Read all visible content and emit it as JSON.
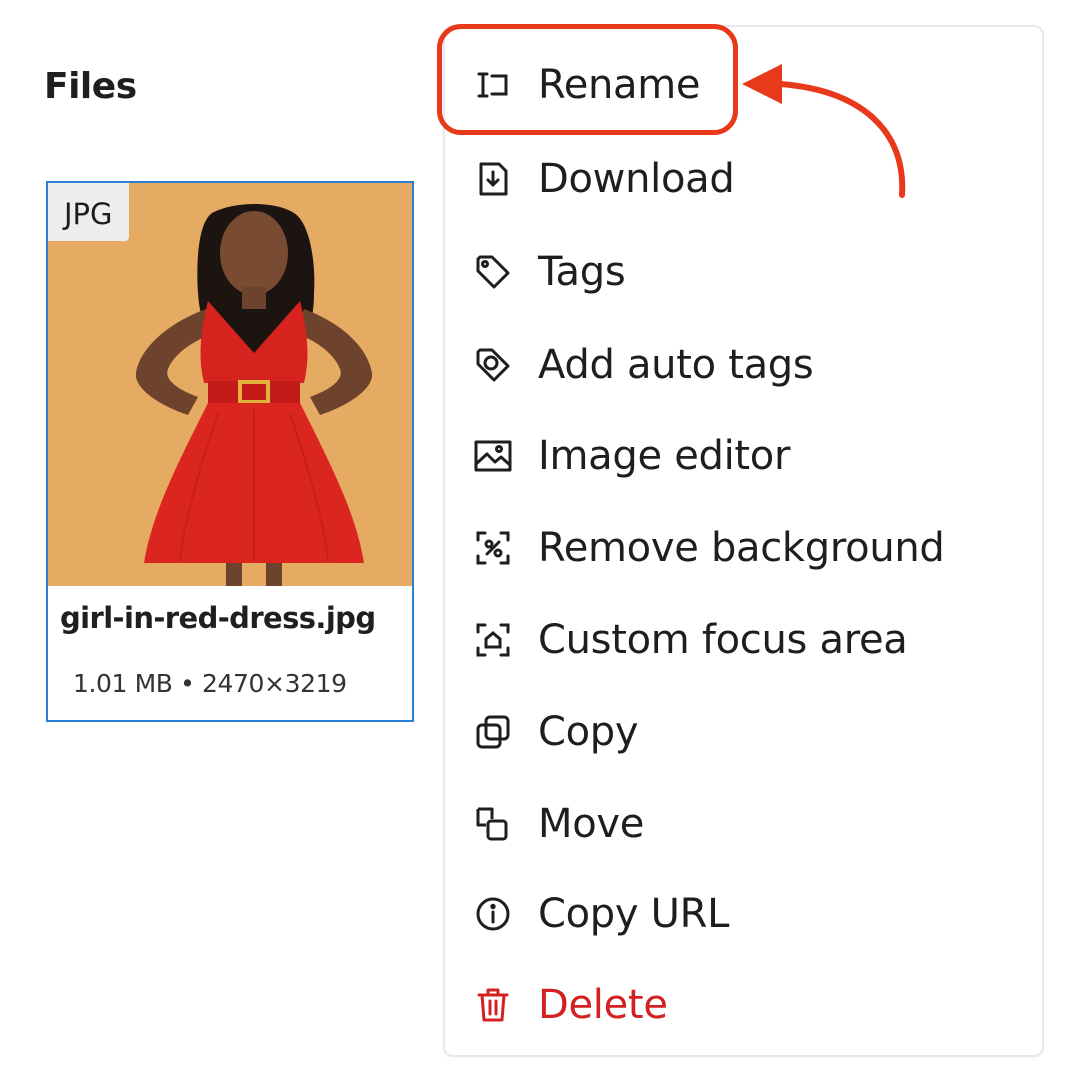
{
  "section_title": "Files",
  "file": {
    "type_badge": "JPG",
    "name": "girl-in-red-dress.jpg",
    "size": "1.01 MB",
    "separator": "•",
    "dimensions": "2470×3219"
  },
  "menu": {
    "items": [
      {
        "label": "Rename",
        "icon": "rename-icon"
      },
      {
        "label": "Download",
        "icon": "download-icon"
      },
      {
        "label": "Tags",
        "icon": "tag-icon"
      },
      {
        "label": "Add auto tags",
        "icon": "auto-tag-icon"
      },
      {
        "label": "Image editor",
        "icon": "image-icon"
      },
      {
        "label": "Remove background",
        "icon": "remove-background-icon"
      },
      {
        "label": "Custom focus area",
        "icon": "focus-area-icon"
      },
      {
        "label": "Copy",
        "icon": "copy-icon"
      },
      {
        "label": "Move",
        "icon": "move-icon"
      },
      {
        "label": "Copy URL",
        "icon": "info-icon"
      },
      {
        "label": "Delete",
        "icon": "trash-icon",
        "danger": true
      }
    ]
  },
  "colors": {
    "accent_border": "#2d7fd3",
    "highlight": "#e8391a",
    "danger": "#d42020",
    "thumbnail_background": "#e5ab62"
  }
}
